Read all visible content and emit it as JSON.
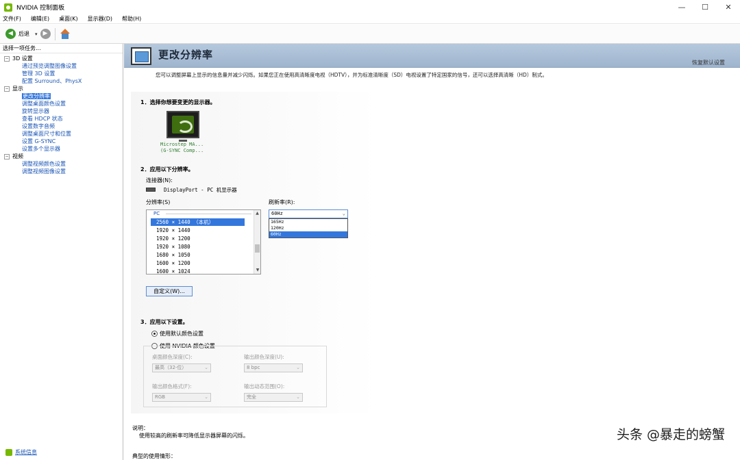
{
  "window": {
    "title": "NVIDIA 控制面板",
    "minimize": "—",
    "maximize": "☐",
    "close": "✕"
  },
  "menu": [
    "文件(F)",
    "编辑(E)",
    "桌面(K)",
    "显示器(D)",
    "帮助(H)"
  ],
  "toolbar": {
    "back_label": "后退",
    "back_dropdown": "▾"
  },
  "left": {
    "header": "选择一项任务...",
    "groups": [
      {
        "label": "3D 设置",
        "toggle": "−",
        "items": [
          "通过预览调整图像设置",
          "管理 3D 设置",
          "配置 Surround、PhysX"
        ]
      },
      {
        "label": "显示",
        "toggle": "−",
        "items": [
          "更改分辨率",
          "调整桌面颜色设置",
          "旋转显示器",
          "查看 HDCP 状态",
          "设置数字音频",
          "调整桌面尺寸和位置",
          "设置 G-SYNC",
          "设置多个显示器"
        ]
      },
      {
        "label": "视频",
        "toggle": "−",
        "items": [
          "调整视频颜色设置",
          "调整视频图像设置"
        ]
      }
    ],
    "sysinfo": "系统信息"
  },
  "page": {
    "title": "更改分辨率",
    "restore_defaults": "恢复默认设置",
    "description": "您可以调整屏幕上显示的信息量并减少闪烁。如果您正在使用高清晰度电视（HDTV），并为标准清晰度（SD）电视设置了特定国家的信号，还可以选择高清晰（HD）制式。",
    "section1": "1．选择你想要变更的显示器。",
    "monitor_name_1": "Microstep MA...",
    "monitor_name_2": "(G-SYNC Comp...",
    "section2": "2．应用以下分辨率。",
    "connector_label": "连接器(N):",
    "connector_value": "DisplayPort - PC 机显示器",
    "resolution_label": "分辨率(S)",
    "refresh_label": "刷新率(R):",
    "res_group": "PC",
    "resolutions": [
      "2560 × 1440 （本机）",
      "1920 × 1440",
      "1920 × 1200",
      "1920 × 1080",
      "1680 × 1050",
      "1600 × 1200",
      "1600 × 1024"
    ],
    "refresh_selected": "60Hz",
    "refresh_options": [
      "165Hz",
      "120Hz",
      "60Hz"
    ],
    "custom_button": "自定义(W)...",
    "section3": "3．应用以下设置。",
    "radio_default": "使用默认颜色设置",
    "radio_nvidia": "使用 NVIDIA 颜色设置",
    "desktop_depth_label": "桌面颜色深度(C):",
    "desktop_depth_value": "最高（32-位）",
    "output_depth_label": "输出颜色深度(U):",
    "output_depth_value": "8 bpc",
    "output_format_label": "输出颜色格式(F):",
    "output_format_value": "RGB",
    "output_range_label": "输出动态范围(O):",
    "output_range_value": "完全",
    "notes_label": "说明：",
    "notes_text": "使用较高的刷新率可降低显示器屏幕的闪烁。",
    "typical_label": "典型的使用情形："
  },
  "watermark": "头条 @暴走的螃蟹"
}
